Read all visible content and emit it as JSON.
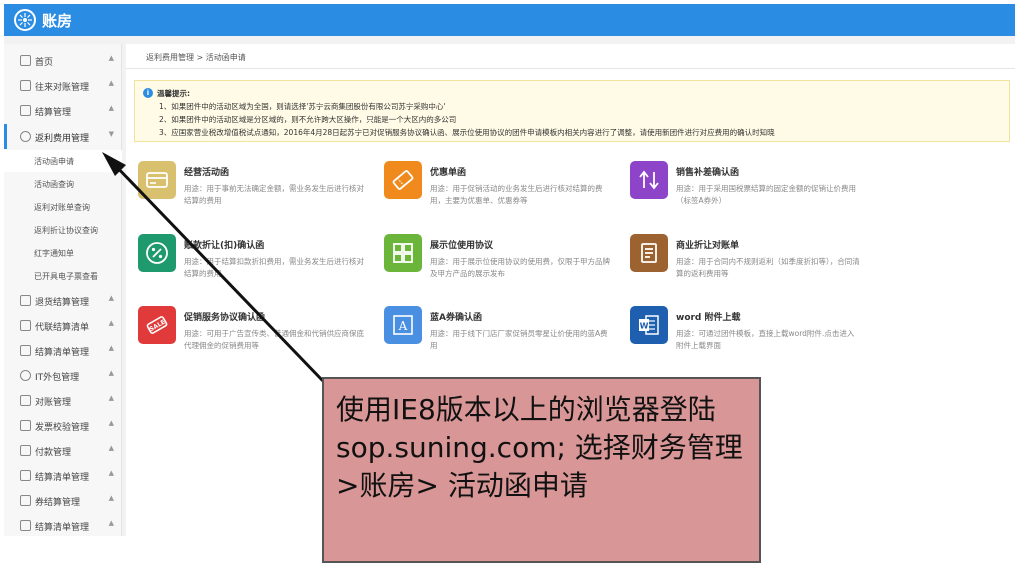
{
  "app": {
    "title": "账房"
  },
  "sidebar": {
    "items": [
      {
        "label": "首页",
        "arrow": "▲"
      },
      {
        "label": "往来对账管理",
        "arrow": "▲"
      },
      {
        "label": "结算管理",
        "arrow": "▲"
      },
      {
        "label": "返利费用管理",
        "arrow": "▼"
      },
      {
        "label": "退货结算管理",
        "arrow": "▲"
      },
      {
        "label": "代联结算清单",
        "arrow": "▲"
      },
      {
        "label": "结算清单管理",
        "arrow": "▲"
      },
      {
        "label": "IT外包管理",
        "arrow": "▲"
      },
      {
        "label": "对账管理",
        "arrow": "▲"
      },
      {
        "label": "发票校验管理",
        "arrow": "▲"
      },
      {
        "label": "付款管理",
        "arrow": "▲"
      },
      {
        "label": "结算清单管理",
        "arrow": "▲"
      },
      {
        "label": "券结算管理",
        "arrow": "▲"
      },
      {
        "label": "结算清单管理",
        "arrow": "▲"
      }
    ],
    "subitems": [
      "活动函申请",
      "活动函查询",
      "返利对账单查询",
      "返利折让协议查询",
      "红字通知单",
      "已开具电子票查看"
    ]
  },
  "breadcrumb": "返利费用管理 > 活动函申请",
  "notice": {
    "title": "温馨提示:",
    "lines": [
      "1、如果团件中的活动区域为全国，则请选择'苏宁云商集团股份有限公司苏宁采购中心'",
      "2、如果团件中的活动区域是分区域的，则不允许跨大区操作，只能是一个大区内的多公司",
      "3、应国家营业税改增值税试点通知，2016年4月28日起苏宁已对促销服务协议确认函、展示位使用协议的团件申请模板内相关内容进行了调整，请使用新团件进行对应费用的确认时知晓"
    ]
  },
  "cards": [
    {
      "title": "经营活动函",
      "desc": "用途：用于事前无法确定金额，需业务发生后进行核对结算的费用",
      "color": "#d8c06e",
      "icon": "card-icon"
    },
    {
      "title": "优惠单函",
      "desc": "用途：用于促销活动的业务发生后进行核对结算的费用，主要为优惠单、优惠券等",
      "color": "#f08a1c",
      "icon": "ticket-icon"
    },
    {
      "title": "销售补差确认函",
      "desc": "用途：用于采用国税票结算的固定金额的促销让价费用（标签A券外）",
      "color": "#8e44c9",
      "icon": "up-down-arrows-icon"
    },
    {
      "title": "账款折让(扣)确认函",
      "desc": "用途：用于结算扣款折扣费用，需业务发生后进行核对结算的费用",
      "color": "#1f9a6f",
      "icon": "percent-icon"
    },
    {
      "title": "展示位使用协议",
      "desc": "用途：用于展示位使用协议的使用费，仅限于甲方品牌及甲方产品的展示发布",
      "color": "#6ab53a",
      "icon": "grid-icon"
    },
    {
      "title": "商业折让对账单",
      "desc": "用途：用于合同内不规则返利（如季度折扣等），合同清算的返利费用等",
      "color": "#9c6330",
      "icon": "document-icon"
    },
    {
      "title": "促销服务协议确认函",
      "desc": "用途：可用于广告宣传类、普通佣金和代销供应商保底代理佣金的促销费用等",
      "color": "#e03a3a",
      "icon": "sale-tag-icon"
    },
    {
      "title": "蓝A券确认函",
      "desc": "用途：用于线下门店厂家促销员零星让价使用的蓝A费用",
      "color": "#4a90e2",
      "icon": "letter-a-icon"
    },
    {
      "title": "word 附件上载",
      "desc": "用途：可通过团件模板，直接上载word附件.点击进入附件上载界面",
      "color": "#1f5fb0",
      "icon": "word-icon"
    }
  ],
  "callout": {
    "text": "使用IE8版本以上的浏览器登陆sop.suning.com; 选择财务管理>账房> 活动函申请"
  }
}
